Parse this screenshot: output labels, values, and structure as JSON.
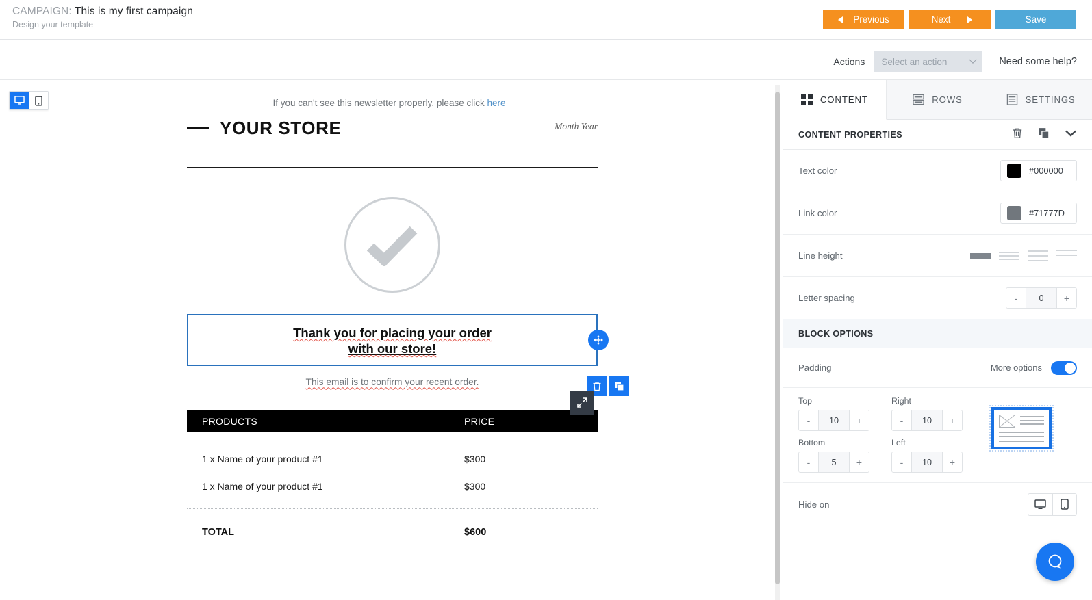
{
  "topbar": {
    "campaign_label": "CAMPAIGN:",
    "campaign_name": "This is my first campaign",
    "subtitle": "Design your template",
    "previous_label": "Previous",
    "next_label": "Next",
    "save_label": "Save"
  },
  "actions": {
    "label": "Actions",
    "select_value": "Select an action",
    "help_label": "Need some help?"
  },
  "email": {
    "preheader_text": "If you can't see this newsletter properly, please click ",
    "preheader_link": "here",
    "store_name": "YOUR STORE",
    "month_year": "Month Year",
    "thanks_line1": "Thank you for placing your order",
    "thanks_line2": "with our store!",
    "confirm_line": "This email is to confirm your recent order.",
    "table": {
      "headers": [
        "PRODUCTS",
        "PRICE"
      ],
      "rows": [
        [
          "1 x Name of your product #1",
          "$300"
        ],
        [
          "1 x Name of your product #1",
          "$300"
        ]
      ],
      "total_label": "TOTAL",
      "total_value": "$600"
    }
  },
  "panel": {
    "tabs": [
      {
        "label": "CONTENT",
        "icon": "grid-icon",
        "active": true
      },
      {
        "label": "ROWS",
        "icon": "rows-icon",
        "active": false
      },
      {
        "label": "SETTINGS",
        "icon": "settings-icon",
        "active": false
      }
    ],
    "properties_title": "CONTENT PROPERTIES",
    "text_color": {
      "label": "Text color",
      "value": "#000000"
    },
    "link_color": {
      "label": "Link color",
      "value": "#71777D"
    },
    "line_height": {
      "label": "Line height",
      "selected_index": 0
    },
    "letter_spacing": {
      "label": "Letter spacing",
      "value": "0",
      "minus": "-",
      "plus": "+"
    },
    "block_options_title": "BLOCK OPTIONS",
    "padding": {
      "label": "Padding",
      "more_options_label": "More options",
      "more_options_on": true,
      "top": {
        "label": "Top",
        "value": "10"
      },
      "right": {
        "label": "Right",
        "value": "10"
      },
      "bottom": {
        "label": "Bottom",
        "value": "5"
      },
      "left": {
        "label": "Left",
        "value": "10"
      },
      "minus": "-",
      "plus": "+"
    },
    "hide_on": {
      "label": "Hide on"
    }
  },
  "colors": {
    "orange": "#f5901f",
    "blue": "#4fa8d8",
    "accent_blue": "#1877f2",
    "selection_blue": "#2a72bd",
    "dark_tool": "#343b45"
  }
}
